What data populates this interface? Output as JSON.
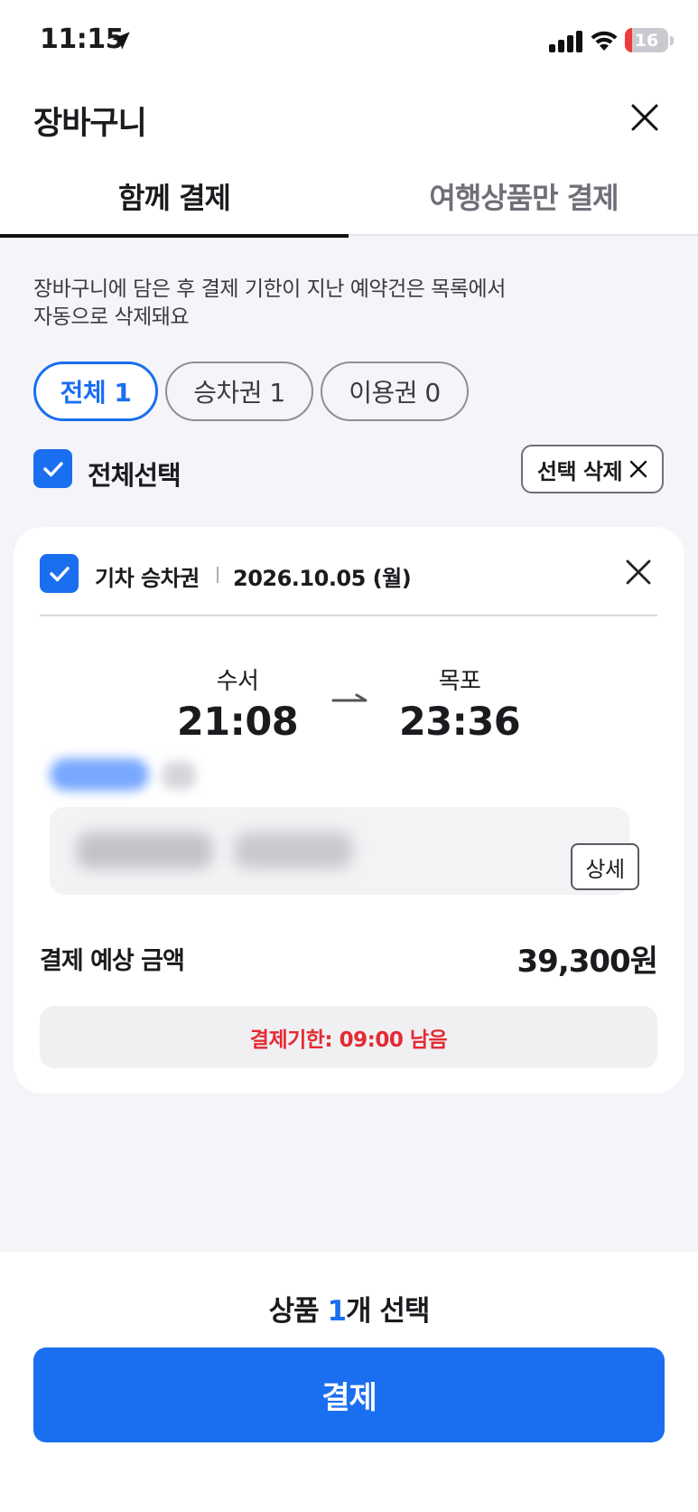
{
  "status_bar": {
    "time": "11:15",
    "battery_level": "16",
    "battery_fraction": 0.16
  },
  "header": {
    "title": "장바구니"
  },
  "tabs": [
    {
      "label": "함께 결제",
      "active": true
    },
    {
      "label": "여행상품만 결제",
      "active": false
    }
  ],
  "notice": {
    "line1": "장바구니에 담은 후 결제 기한이 지난 예약건은 목록에서",
    "line2": "자동으로 삭제돼요"
  },
  "filters": [
    {
      "label": "전체 1",
      "active": true
    },
    {
      "label": "승차권 1",
      "active": false
    },
    {
      "label": "이용권 0",
      "active": false
    }
  ],
  "selection": {
    "select_all_label": "전체선택",
    "select_all_checked": true,
    "delete_label": "선택 삭제"
  },
  "cart_item": {
    "checked": true,
    "type": "기차 승차권",
    "date": "2026.10.05 (월)",
    "departure": {
      "station": "수서",
      "time": "21:08"
    },
    "arrival": {
      "station": "목포",
      "time": "23:36"
    },
    "detail_label": "상세",
    "price_label": "결제 예상 금액",
    "price": "39,300원",
    "deadline": "결제기한: 09:00 남음"
  },
  "footer": {
    "summary_prefix": "상품 ",
    "summary_count": "1",
    "summary_suffix": "개 선택",
    "pay_label": "결제"
  },
  "colors": {
    "accent": "#1a6ef0",
    "deadline_text": "#e52a33",
    "page_background": "#f4f4f9"
  },
  "icons": [
    "location-arrow-icon",
    "cellular-signal-icon",
    "wifi-icon",
    "battery-icon",
    "close-icon",
    "check-icon",
    "route-arrow-icon"
  ]
}
